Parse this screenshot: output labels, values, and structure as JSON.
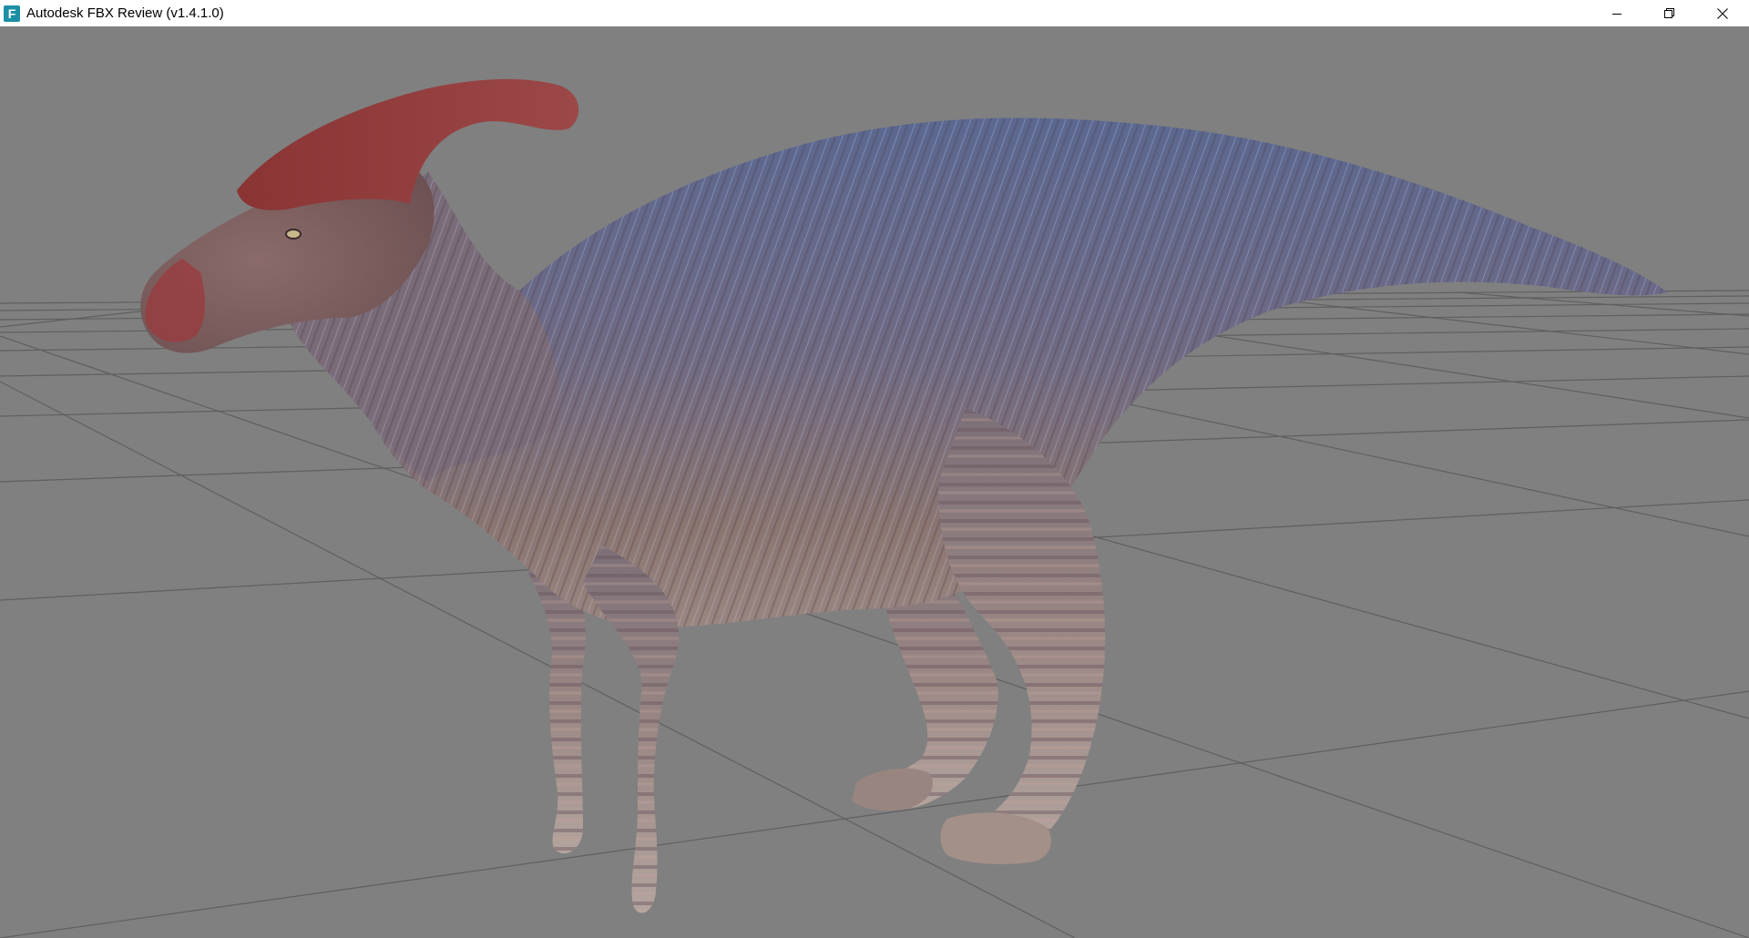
{
  "window": {
    "title": "Autodesk FBX Review (v1.4.1.0)",
    "app_icon_letter": "F",
    "icon_color": "#1c8fa6"
  },
  "controls": {
    "minimize": "minimize-icon",
    "restore": "restore-icon",
    "close": "close-icon"
  },
  "viewport": {
    "background": "#808080",
    "grid_color": "#5e5e5e",
    "model_name": "parasaurolophus-model"
  }
}
